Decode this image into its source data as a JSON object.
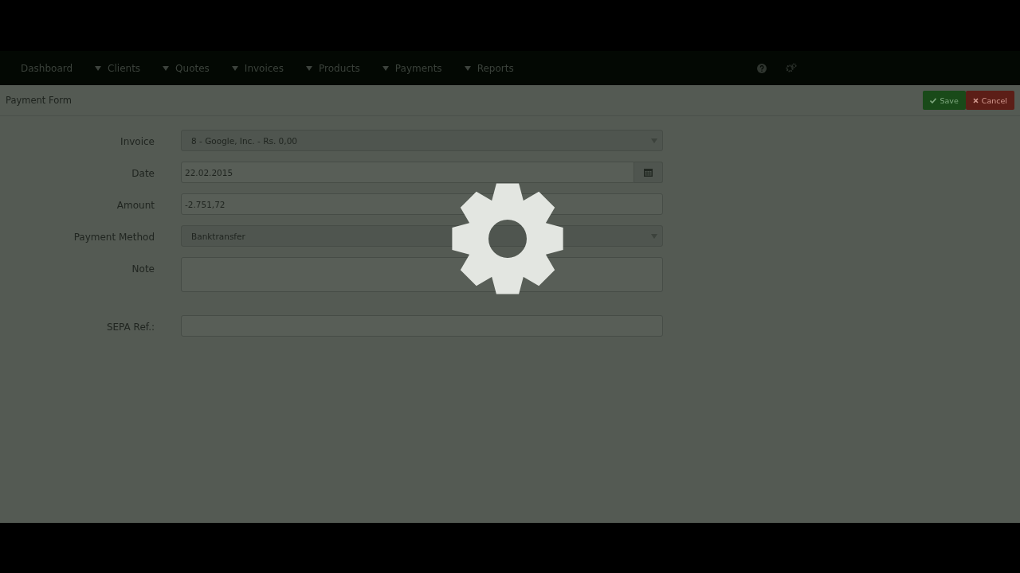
{
  "navbar": {
    "items": [
      {
        "label": "Dashboard",
        "dropdown": false
      },
      {
        "label": "Clients",
        "dropdown": true
      },
      {
        "label": "Quotes",
        "dropdown": true
      },
      {
        "label": "Invoices",
        "dropdown": true
      },
      {
        "label": "Products",
        "dropdown": true
      },
      {
        "label": "Payments",
        "dropdown": true
      },
      {
        "label": "Reports",
        "dropdown": true
      }
    ]
  },
  "page": {
    "title": "Payment Form",
    "buttons": [
      {
        "label": "Save",
        "kind": "save"
      },
      {
        "label": "Cancel",
        "kind": "cancel"
      }
    ]
  },
  "form": {
    "fields": [
      {
        "label": "Invoice",
        "kind": "select",
        "value": "8 - Google, Inc. - Rs. 0,00"
      },
      {
        "label": "Date",
        "kind": "date",
        "value": "22.02.2015"
      },
      {
        "label": "Amount",
        "kind": "text",
        "value": "-2.751,72"
      },
      {
        "label": "Payment Method",
        "kind": "select",
        "value": "Banktransfer"
      },
      {
        "label": "Note",
        "kind": "textarea"
      },
      {
        "label": "SEPA Ref.:",
        "kind": "text"
      }
    ]
  },
  "loading": {
    "kind": "spinner"
  }
}
